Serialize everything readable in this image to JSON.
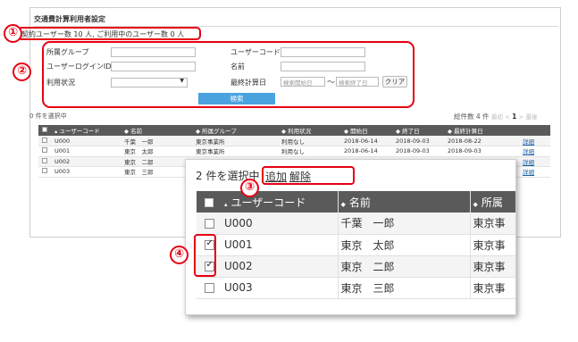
{
  "page": {
    "title": "交通費計算利用者設定",
    "contract_info": "契約ユーザー数 10 人, ご利用中のユーザー数 0 人"
  },
  "search": {
    "group_label": "所属グループ",
    "user_code_label": "ユーザーコード",
    "login_id_label": "ユーザーログインID",
    "name_label": "名前",
    "status_label": "利用状況",
    "last_calc_label": "最終計算日",
    "date_start_placeholder": "検索開始日",
    "date_end_placeholder": "検索終了日",
    "tilde": "～",
    "clear_button": "クリア",
    "search_button": "検索"
  },
  "list": {
    "selected_count": "0 件を選択中",
    "pager": {
      "total": "総件数 4 件",
      "first": "最初",
      "prev": "<",
      "current": "1",
      "next": ">",
      "last": "最後"
    },
    "columns": [
      "ユーザーコード",
      "名前",
      "所属グループ",
      "利用状況",
      "開始日",
      "終了日",
      "最終計算日"
    ],
    "rows": [
      {
        "code": "U000",
        "name": "千葉　一郎",
        "group": "東京事業所",
        "status": "利用なし",
        "start": "2018-06-14",
        "end": "2018-09-03",
        "last": "2018-08-22",
        "detail": "詳細"
      },
      {
        "code": "U001",
        "name": "東京　太郎",
        "group": "東京事業所",
        "status": "利用なし",
        "start": "2018-06-14",
        "end": "2018-09-03",
        "last": "2018-09-03",
        "detail": "詳細"
      },
      {
        "code": "U002",
        "name": "東京　二郎",
        "group": "",
        "status": "",
        "start": "",
        "end": "",
        "last": "",
        "detail": "詳細"
      },
      {
        "code": "U003",
        "name": "東京　三郎",
        "group": "",
        "status": "",
        "start": "",
        "end": "",
        "last": "",
        "detail": "詳細"
      }
    ]
  },
  "zoom": {
    "selected_prefix": "2 件を選択中",
    "add_link": "追加",
    "remove_link": "解除",
    "columns": [
      "ユーザーコード",
      "名前",
      "所属"
    ],
    "rows": [
      {
        "code": "U000",
        "name": "千葉　一郎",
        "group": "東京事",
        "checked": false
      },
      {
        "code": "U001",
        "name": "東京　太郎",
        "group": "東京事",
        "checked": true
      },
      {
        "code": "U002",
        "name": "東京　二郎",
        "group": "東京事",
        "checked": true
      },
      {
        "code": "U003",
        "name": "東京　三郎",
        "group": "東京事",
        "checked": false
      }
    ]
  },
  "markers": [
    "①",
    "②",
    "③",
    "④"
  ],
  "colors": {
    "highlight": "#e60012",
    "header": "#5a5a5a",
    "search_button": "#4aa3df",
    "link": "#1a5fa8"
  }
}
